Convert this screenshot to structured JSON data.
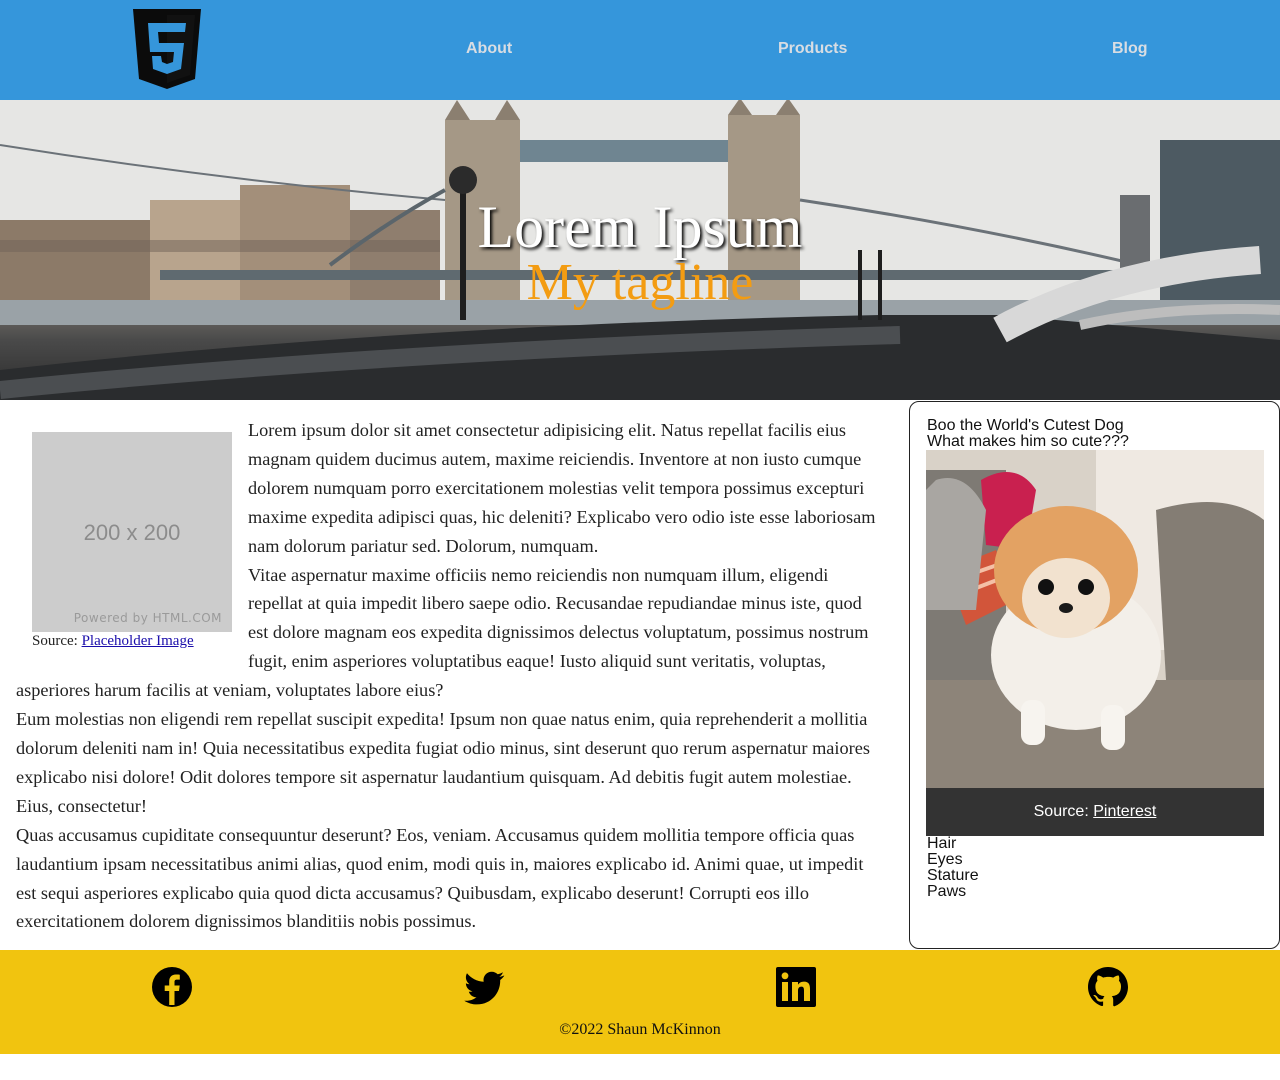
{
  "header": {
    "logo_icon": "html5-logo-icon",
    "nav": [
      {
        "label": "About"
      },
      {
        "label": "Products"
      },
      {
        "label": "Blog"
      }
    ],
    "background": "#3596db"
  },
  "hero": {
    "title": "Lorem Ipsum",
    "tagline": "My tagline",
    "tagline_color": "#f39c12",
    "image_description": "Tower Bridge photo background"
  },
  "main": {
    "placeholder": {
      "size_text": "200 x 200",
      "powered_text": "Powered by HTML.COM",
      "caption_prefix": "Source: ",
      "caption_link": "Placeholder Image"
    },
    "paragraphs": [
      "Lorem ipsum dolor sit amet consectetur adipisicing elit. Natus repellat facilis eius magnam quidem ducimus autem, maxime reiciendis. Inventore at non iusto cumque dolorem numquam porro exercitationem molestias velit tempora possimus excepturi maxime expedita adipisci quas, hic deleniti? Explicabo vero odio iste esse laboriosam nam dolorum pariatur sed. Dolorum, numquam.",
      "Vitae aspernatur maxime officiis nemo reiciendis non numquam illum, eligendi repellat at quia impedit libero saepe odio. Recusandae repudiandae minus iste, quod est dolore magnam eos expedita dignissimos delectus voluptatum, possimus nostrum fugit, enim asperiores voluptatibus eaque! Iusto aliquid sunt veritatis, voluptas, asperiores harum facilis at veniam, voluptates labore eius?",
      "Eum molestias non eligendi rem repellat suscipit expedita! Ipsum non quae natus enim, quia reprehenderit a mollitia dolorum deleniti nam in! Quia necessitatibus expedita fugiat odio minus, sint deserunt quo rerum aspernatur maiores explicabo nisi dolore! Odit dolores tempore sit aspernatur laudantium quisquam. Ad debitis fugit autem molestiae. Eius, consectetur!",
      "Quas accusamus cupiditate consequuntur deserunt? Eos, veniam. Accusamus quidem mollitia tempore officia quas laudantium ipsam necessitatibus animi alias, quod enim, modi quis in, maiores explicabo id. Animi quae, ut impedit est sequi asperiores explicabo quia quod dicta accusamus? Quibusdam, explicabo deserunt! Corrupti eos illo exercitationem dolorem dignissimos blanditiis nobis possimus."
    ]
  },
  "aside": {
    "heading": "Boo the World's Cutest Dog",
    "subheading": "What makes him so cute???",
    "caption_prefix": "Source: ",
    "caption_link": "Pinterest",
    "list": [
      "Hair",
      "Eyes",
      "Stature",
      "Paws"
    ]
  },
  "footer": {
    "social": [
      {
        "icon": "facebook-icon"
      },
      {
        "icon": "twitter-icon"
      },
      {
        "icon": "linkedin-icon"
      },
      {
        "icon": "github-icon"
      }
    ],
    "copyright": "©2022 Shaun McKinnon",
    "background": "#f1c40f"
  }
}
